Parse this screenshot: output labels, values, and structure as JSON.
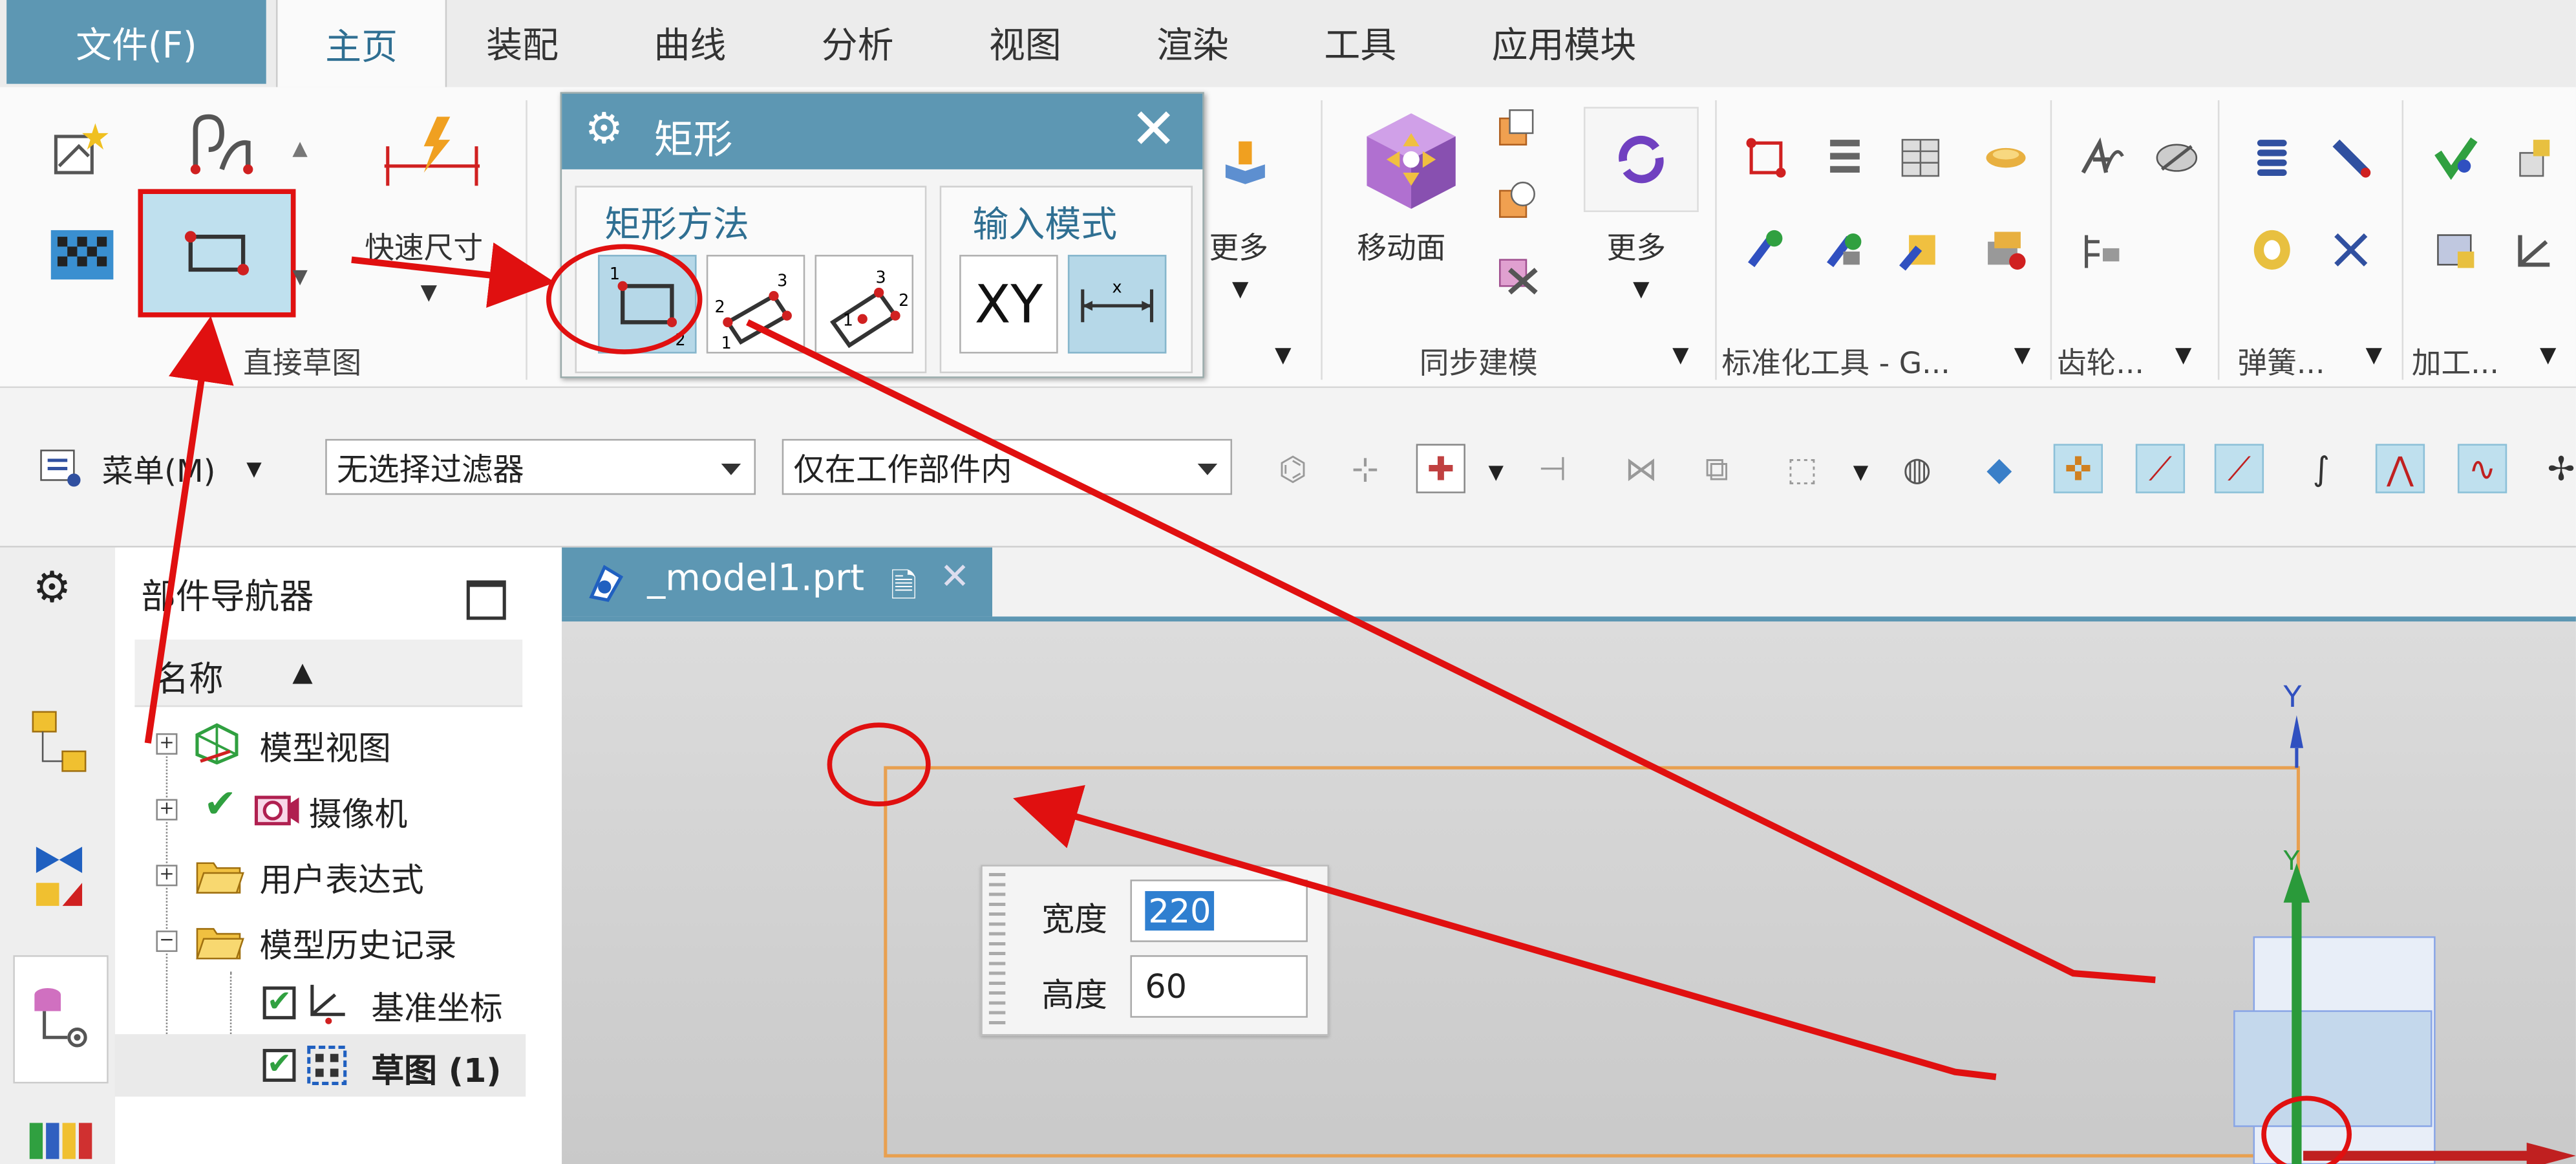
{
  "menubar": {
    "file": "文件(F)",
    "tabs": [
      "主页",
      "装配",
      "曲线",
      "分析",
      "视图",
      "渲染",
      "工具",
      "应用模块"
    ]
  },
  "ribbon": {
    "quick_dim_label": "快速尺寸",
    "direct_sketch_group": "直接草图",
    "more_label": "更多",
    "move_face_label": "移动面",
    "sync_modeling_group": "同步建模",
    "standard_tools_group": "标准化工具 - G...",
    "gear_group": "齿轮...",
    "spring_group": "弹簧...",
    "machining_group": "加工..."
  },
  "dialog": {
    "title": "矩形",
    "method_title": "矩形方法",
    "input_mode_title": "输入模式",
    "xy_label": "XY"
  },
  "toolbar": {
    "menu_label": "菜单(M)",
    "filter_value": "无选择过滤器",
    "scope_value": "仅在工作部件内"
  },
  "navigator": {
    "title": "部件导航器",
    "column_name": "名称",
    "nodes": [
      "模型视图",
      "摄像机",
      "用户表达式",
      "模型历史记录",
      "基准坐标",
      "草图 (1)"
    ]
  },
  "graphics": {
    "tab_label": "_model1.prt",
    "width_label": "宽度",
    "width_value": "220",
    "height_label": "高度",
    "height_value": "60",
    "axis_y": "Y"
  },
  "colors": {
    "accent": "#5d97b3",
    "annotation_red": "#e01010",
    "sketch_orange": "#e8a050"
  }
}
